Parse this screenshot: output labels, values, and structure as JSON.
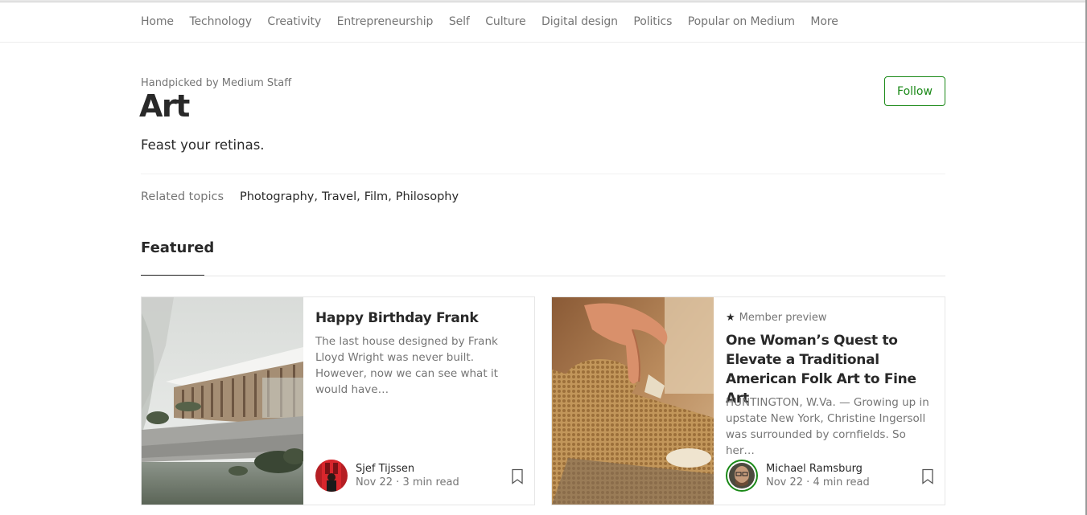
{
  "nav": {
    "items": [
      "Home",
      "Technology",
      "Creativity",
      "Entrepreneurship",
      "Self",
      "Culture",
      "Digital design",
      "Politics",
      "Popular on Medium",
      "More"
    ]
  },
  "header": {
    "handpicked": "Handpicked by Medium Staff",
    "title": "Art",
    "tagline": "Feast your retinas.",
    "follow_label": "Follow"
  },
  "related": {
    "label": "Related topics",
    "topics": [
      "Photography",
      "Travel",
      "Film",
      "Philosophy"
    ]
  },
  "featured": {
    "label": "Featured",
    "cards": [
      {
        "member_preview": "",
        "title": "Happy Birthday Frank",
        "excerpt": "The last house designed by Frank Lloyd Wright was never built. However, now we can see what it would have…",
        "author": "Sjef Tijssen",
        "meta": "Nov 22 · 3 min read",
        "thumb_icon": "house-rendering-image",
        "avatar_icon": "avatar-image"
      },
      {
        "member_preview": "Member preview",
        "title": "One Woman’s Quest to Elevate a Traditional American Folk Art to Fine Art",
        "excerpt": "HUNTINGTON, W.Va. — Growing up in upstate New York, Christine Ingersoll was surrounded by cornfields. So her…",
        "author": "Michael Ramsburg",
        "meta": "Nov 22 · 4 min read",
        "thumb_icon": "corn-husk-doll-image",
        "avatar_icon": "avatar-image"
      }
    ]
  },
  "colors": {
    "accent": "#1a8917",
    "text": "#292929",
    "muted": "#757575"
  }
}
